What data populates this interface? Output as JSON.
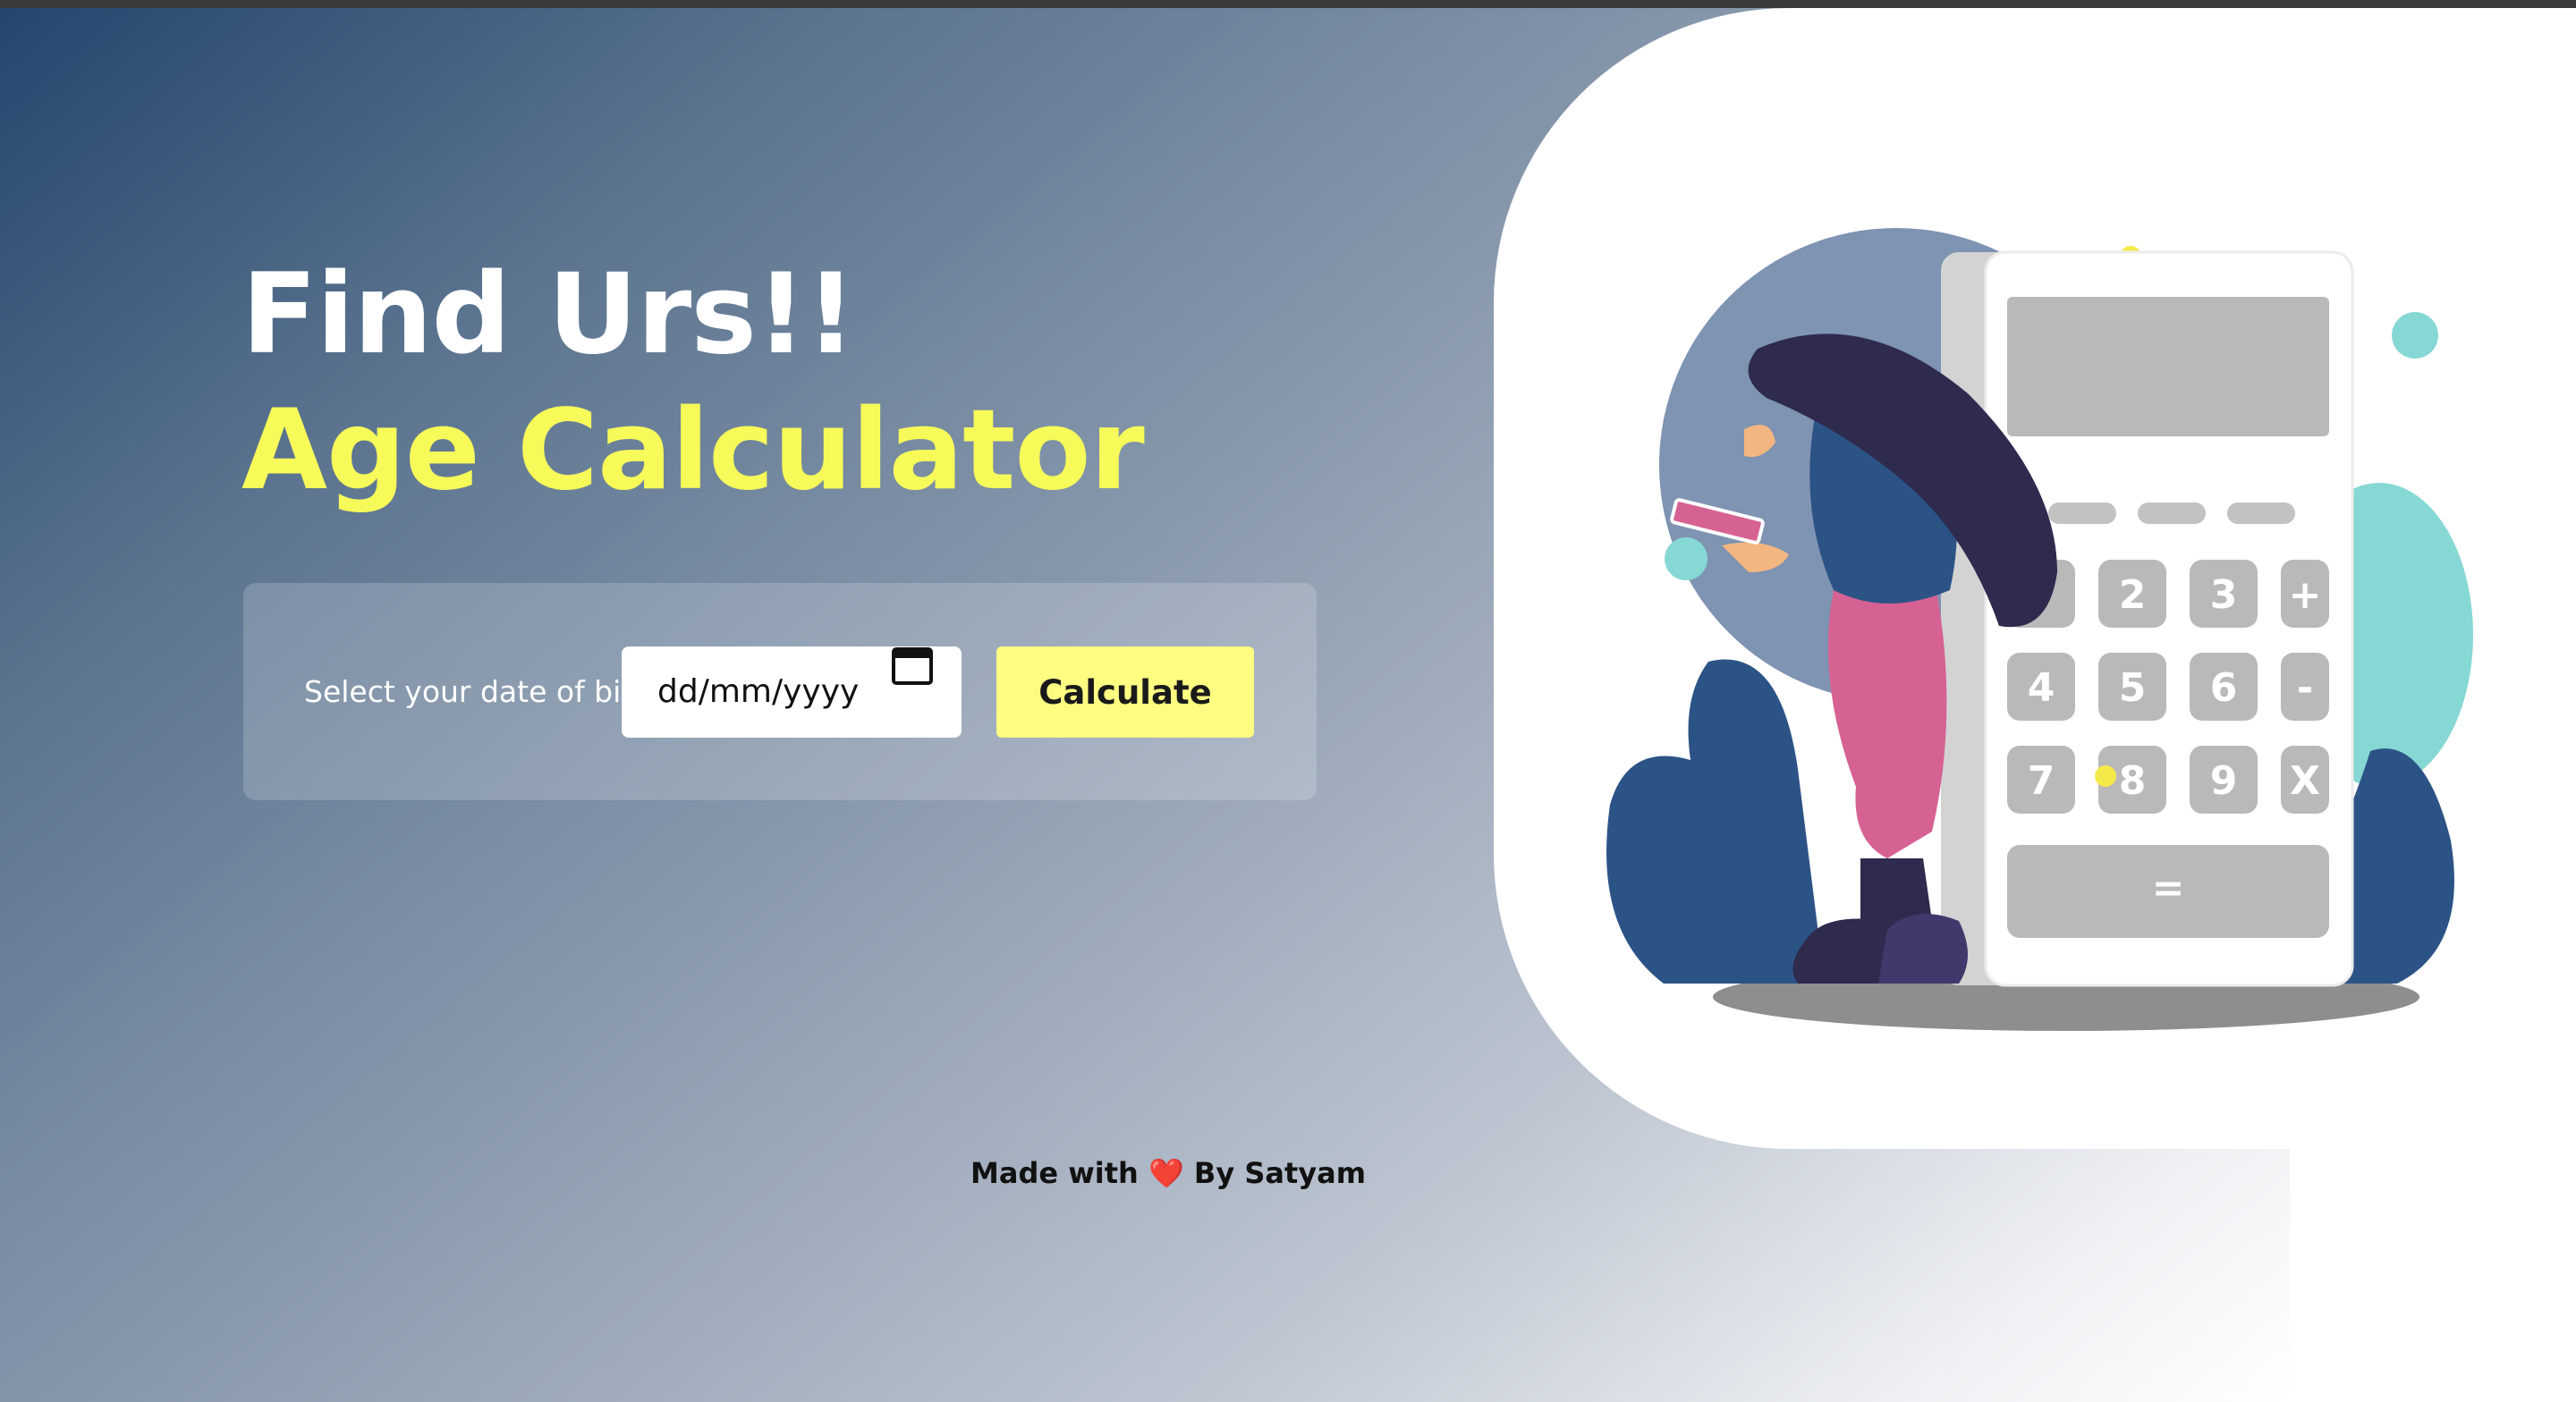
{
  "hero": {
    "title_line1": "Find Urs!!",
    "title_line2": "Age Calculator"
  },
  "form": {
    "dob_label": "Select your date of birth:",
    "dob_placeholder": "dd/mm/yyyy",
    "calculate_label": "Calculate"
  },
  "footer": {
    "prefix": "Made with",
    "heart": "❤️",
    "suffix": "By Satyam"
  },
  "illustration": {
    "keys": [
      "2",
      "3",
      "+",
      "4",
      "5",
      "6",
      "-",
      "7",
      "8",
      "9",
      "X",
      "="
    ]
  },
  "colors": {
    "accent_yellow": "#f6fb5a",
    "button_yellow": "#fdfd82",
    "gradient_dark": "#24466e",
    "teal": "#86d8d4",
    "navy": "#2c5386",
    "pink": "#d66193"
  },
  "icons": {
    "date_picker": "calendar-icon",
    "footer": "heart-icon"
  }
}
